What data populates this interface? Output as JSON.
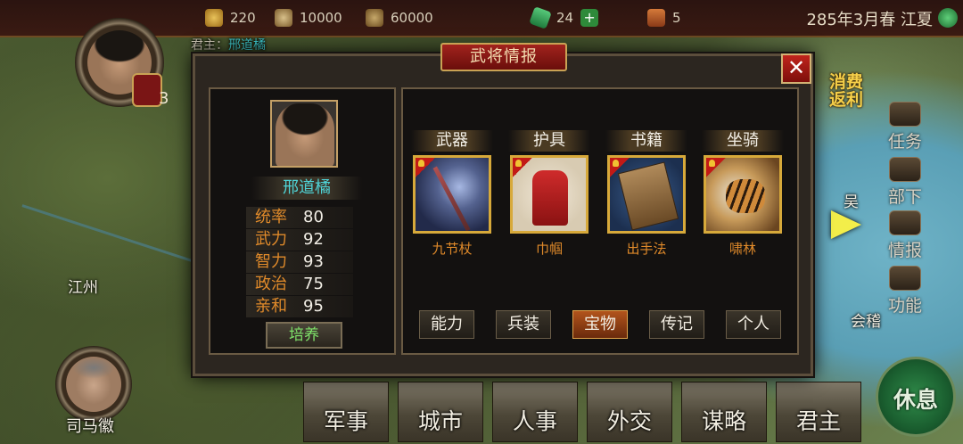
{
  "topbar": {
    "resources": [
      {
        "icon": "gold-icon",
        "value": "220"
      },
      {
        "icon": "food-icon",
        "value": "10000"
      },
      {
        "icon": "wood-icon",
        "value": "60000"
      },
      {
        "icon": "gem-icon",
        "value": "24"
      },
      {
        "icon": "book-icon",
        "value": "5"
      }
    ],
    "date": "285年3月春",
    "city": "江夏"
  },
  "map": {
    "ruler_label": "君主：",
    "ruler_name": "邢道橘",
    "ruler_badge": "3",
    "labels": {
      "jiangzhou": "江州",
      "wu": "吴",
      "kuaiji": "会稽",
      "advisor": "司马徽"
    },
    "promo": [
      "消费",
      "返利"
    ]
  },
  "right_menu": [
    "任务",
    "部下",
    "情报",
    "功能"
  ],
  "bottom_nav": [
    "军事",
    "城市",
    "人事",
    "外交",
    "谋略",
    "君主"
  ],
  "rest_button": "休息",
  "dialog": {
    "title": "武将情报",
    "close": "✕",
    "general": {
      "name": "邢道橘",
      "stats": [
        {
          "label": "统率",
          "value": "80"
        },
        {
          "label": "武力",
          "value": "92"
        },
        {
          "label": "智力",
          "value": "93"
        },
        {
          "label": "政治",
          "value": "75"
        },
        {
          "label": "亲和",
          "value": "95"
        }
      ],
      "train_button": "培养"
    },
    "equipment": [
      {
        "slot": "武器",
        "item": "九节杖"
      },
      {
        "slot": "护具",
        "item": "巾帼"
      },
      {
        "slot": "书籍",
        "item": "出手法"
      },
      {
        "slot": "坐骑",
        "item": "啸林"
      }
    ],
    "tabs": [
      {
        "label": "能力",
        "active": false
      },
      {
        "label": "兵装",
        "active": false
      },
      {
        "label": "宝物",
        "active": true
      },
      {
        "label": "传记",
        "active": false
      },
      {
        "label": "个人",
        "active": false
      }
    ]
  }
}
